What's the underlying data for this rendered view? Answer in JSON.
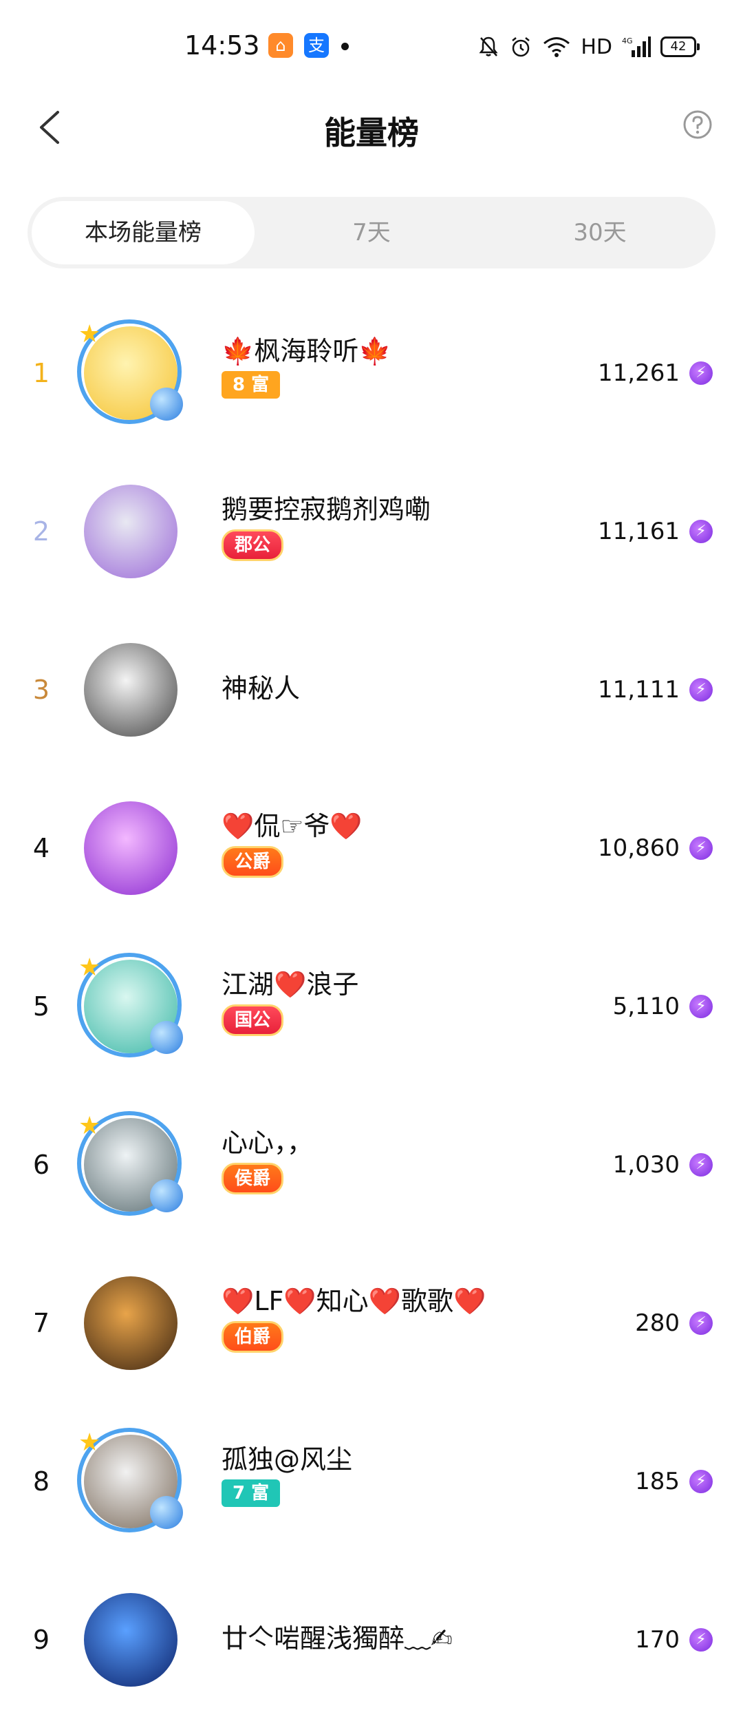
{
  "status_bar": {
    "time": "14:53",
    "app_icons": [
      {
        "name": "home-app-icon",
        "color": "#ff8a2a",
        "glyph": "⌂"
      },
      {
        "name": "alipay-icon",
        "color": "#1677ff",
        "glyph": "支"
      }
    ],
    "network": "HD",
    "signal": "4G",
    "battery": "42"
  },
  "header": {
    "title": "能量榜",
    "back_icon": "chevron-left-icon",
    "help_icon": "question-circle-icon"
  },
  "tabs": [
    {
      "label": "本场能量榜",
      "active": true
    },
    {
      "label": "7天",
      "active": false
    },
    {
      "label": "30天",
      "active": false
    }
  ],
  "energy_icon": "lightning-icon",
  "leaderboard": [
    {
      "rank": "1",
      "rank_color": "#f3b21b",
      "name": "🍁枫海聆听🍁",
      "badge": "8 富",
      "badge_type": "wealth",
      "score": "11,261",
      "avatar_colors": [
        "#fff3b0",
        "#f5c233"
      ]
    },
    {
      "rank": "2",
      "rank_color": "#a8b4e6",
      "name": "鹅要控寂鹅剂鸡嘞",
      "badge": "郡公",
      "badge_type": "noble-red",
      "score": "11,161",
      "avatar_colors": [
        "#e8e8f2",
        "#9b6ad8"
      ]
    },
    {
      "rank": "3",
      "rank_color": "#c9893a",
      "name": "神秘人",
      "badge": "",
      "badge_type": "none",
      "score": "11,111",
      "avatar_colors": [
        "#f4f4f4",
        "#444444"
      ]
    },
    {
      "rank": "4",
      "rank_color": "#111111",
      "name": "❤️侃☞爷❤️",
      "badge": "公爵",
      "badge_type": "noble",
      "score": "10,860",
      "avatar_colors": [
        "#f3b8ff",
        "#8a2ad0"
      ]
    },
    {
      "rank": "5",
      "rank_color": "#111111",
      "name": "江湖❤️浪子",
      "badge": "国公",
      "badge_type": "noble-red",
      "score": "5,110",
      "avatar_colors": [
        "#d9f7f0",
        "#3bb7a6"
      ]
    },
    {
      "rank": "6",
      "rank_color": "#111111",
      "name": "心心，，",
      "badge": "侯爵",
      "badge_type": "noble",
      "score": "1,030",
      "avatar_colors": [
        "#eef3f5",
        "#5a6c70"
      ]
    },
    {
      "rank": "7",
      "rank_color": "#111111",
      "name": "❤️LF❤️知心❤️歌歌❤️",
      "badge": "伯爵",
      "badge_type": "noble",
      "score": "280",
      "avatar_colors": [
        "#e8a44a",
        "#3a2310"
      ]
    },
    {
      "rank": "8",
      "rank_color": "#111111",
      "name": "孤独@风尘",
      "badge": "7 富",
      "badge_type": "wealth-teal",
      "score": "185",
      "avatar_colors": [
        "#f1f1f1",
        "#7a6a5a"
      ]
    },
    {
      "rank": "9",
      "rank_color": "#111111",
      "name": "廿亽啱醒浅獨醉﹏✍",
      "badge": "",
      "badge_type": "none",
      "score": "170",
      "avatar_colors": [
        "#5aa0ff",
        "#0a1f66"
      ]
    }
  ]
}
